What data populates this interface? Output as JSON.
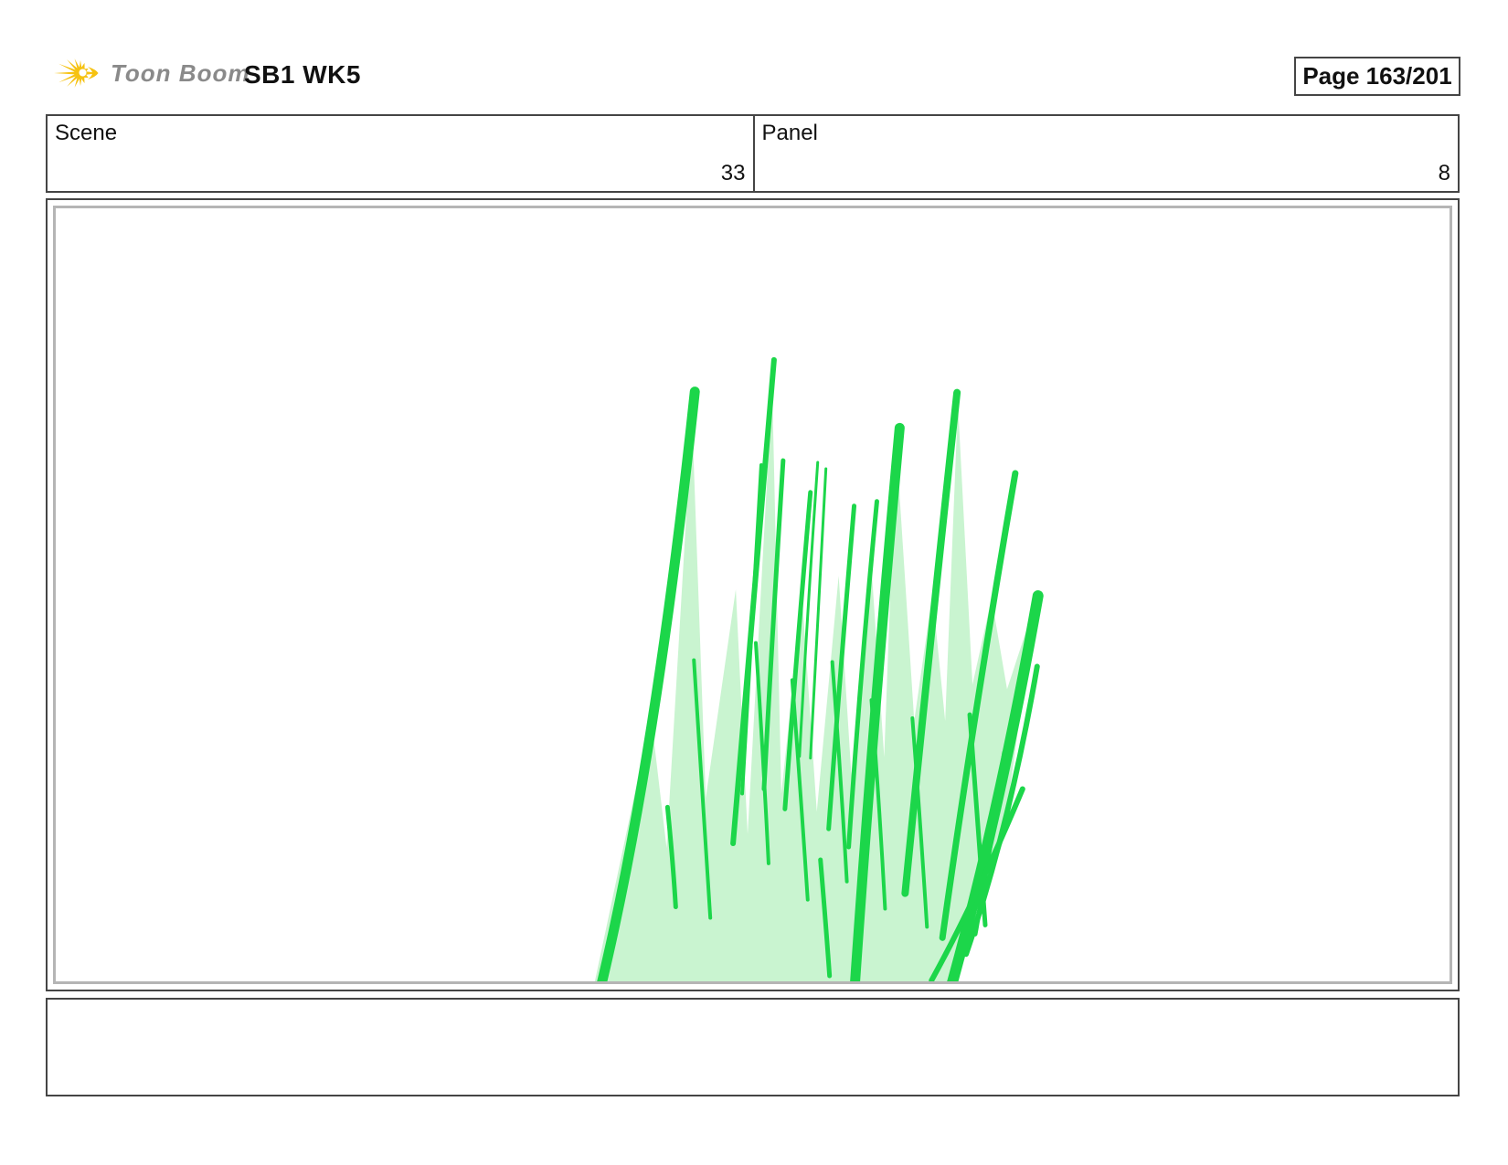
{
  "header": {
    "logo_text": "Toon Boom",
    "title": "SB1 WK5",
    "page_label": "Page 163/201"
  },
  "info_row": {
    "scene_label": "Scene",
    "scene_value": "33",
    "panel_label": "Panel",
    "panel_value": "8"
  },
  "panel": {
    "caption_text": "",
    "artwork": "tuft-of-grass-blades-bright-green-strokes-over-light-green-fill-clipped-at-panel-bottom"
  },
  "colors": {
    "blade_green": "#1cd64a",
    "fill_green": "#c9f4d0",
    "logo_yellow": "#f6c211",
    "logo_text_gray": "#8a8a8a",
    "border_dark": "#454545",
    "border_gray": "#b5b5b5",
    "text_black": "#111111"
  }
}
